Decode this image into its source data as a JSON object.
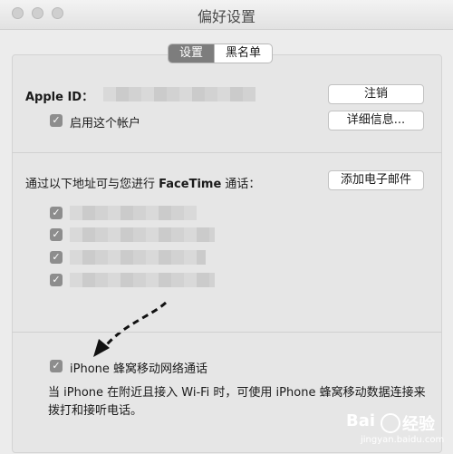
{
  "window": {
    "title": "偏好设置"
  },
  "tabs": [
    {
      "label": "设置",
      "selected": true
    },
    {
      "label": "黑名单",
      "selected": false
    }
  ],
  "account": {
    "label": "Apple ID：",
    "value_redacted": true,
    "sign_out_label": "注销",
    "details_label": "详细信息...",
    "enable_label": "启用这个帐户",
    "enable_checked": true
  },
  "addresses": {
    "heading_prefix": "通过以下地址可与您进行",
    "heading_brand": "FaceTime",
    "heading_suffix": "通话：",
    "add_email_label": "添加电子邮件",
    "items": [
      {
        "checked": true,
        "redacted": true
      },
      {
        "checked": true,
        "redacted": true
      },
      {
        "checked": true,
        "redacted": true
      },
      {
        "checked": true,
        "redacted": true
      }
    ]
  },
  "cellular": {
    "label": "iPhone 蜂窝移动网络通话",
    "checked": true,
    "description": "当 iPhone 在附近且接入 Wi-Fi 时，可使用 iPhone 蜂窝移动数据连接来拨打和接听电话。"
  },
  "watermark": {
    "brand": "Bai",
    "brand2": "经验",
    "url": "jingyan.baidu.com"
  },
  "colors": {
    "selected_tab": "#7d7d7d",
    "checkbox": "#8d8d8d",
    "window_bg": "#ececec"
  }
}
